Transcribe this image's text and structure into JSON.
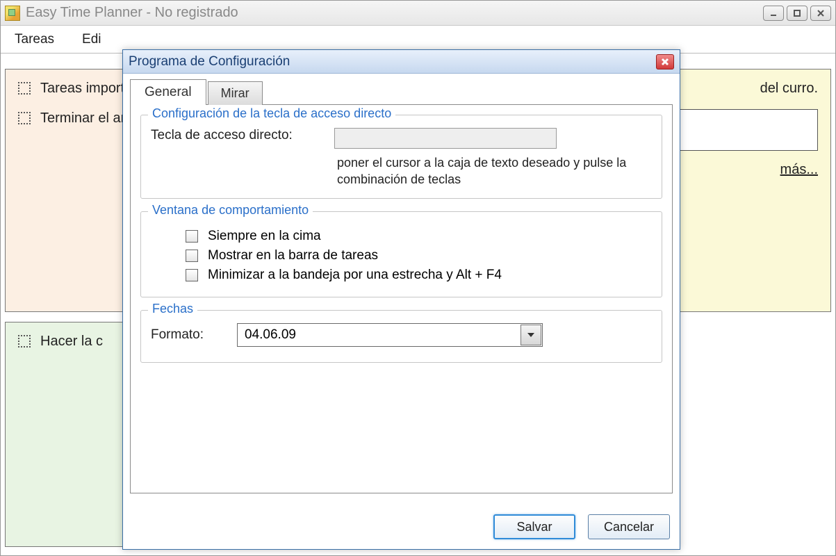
{
  "window": {
    "title": "Easy Time Planner - No registrado"
  },
  "menubar": {
    "items": [
      "Tareas",
      "Edi"
    ]
  },
  "panes": {
    "topLeft": {
      "tasks": [
        "Tareas importantes que NO tienen que hacerse d",
        "Terminar el análisis de Uptodown"
      ]
    },
    "topRight": {
      "task": "del curro.",
      "more_label": "más..."
    },
    "bottomLeft": {
      "task": "Hacer la c"
    }
  },
  "dialog": {
    "title": "Programa de Configuración",
    "tabs": {
      "general": "General",
      "mirar": "Mirar"
    },
    "group_hotkey": {
      "legend": "Configuración de la tecla de acceso directo",
      "label": "Tecla de acceso directo:",
      "value": "",
      "hint": "poner el cursor a la caja de texto deseado y pulse la combinación de teclas"
    },
    "group_window": {
      "legend": "Ventana de comportamiento",
      "opts": {
        "ontop": "Siempre en la cima",
        "taskbar": "Mostrar en la barra de tareas",
        "tray": "Minimizar a la bandeja por una estrecha y Alt + F4"
      }
    },
    "group_dates": {
      "legend": "Fechas",
      "label": "Formato:",
      "value": "04.06.09"
    },
    "buttons": {
      "save": "Salvar",
      "cancel": "Cancelar"
    }
  }
}
